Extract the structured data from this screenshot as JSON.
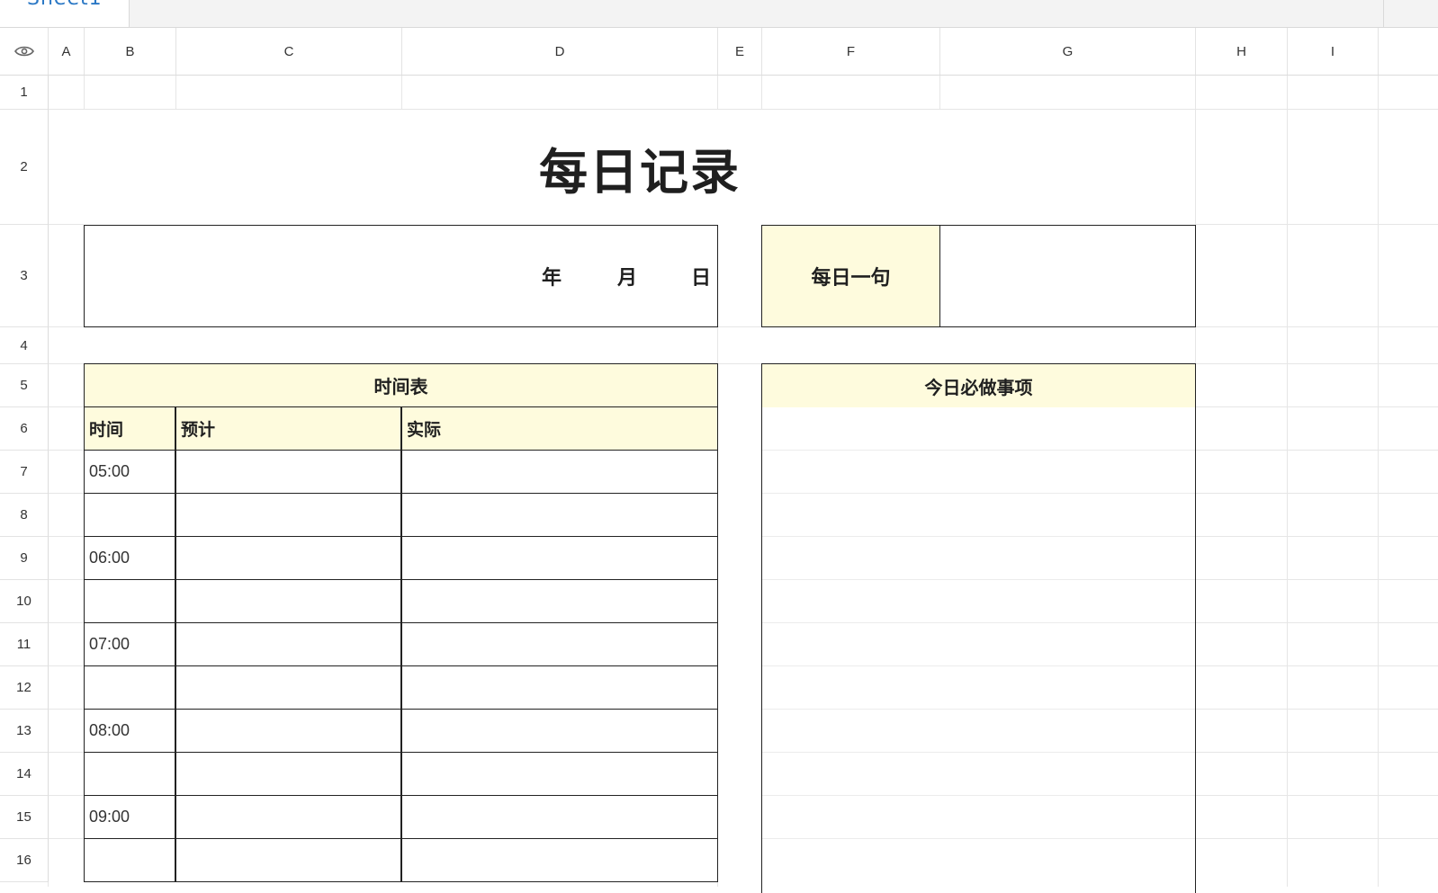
{
  "sheet_tab": {
    "label": "Sheet1"
  },
  "columns": [
    "A",
    "B",
    "C",
    "D",
    "E",
    "F",
    "G",
    "H",
    "I"
  ],
  "rows": [
    "1",
    "2",
    "3",
    "4",
    "5",
    "6",
    "7",
    "8",
    "9",
    "10",
    "11",
    "12",
    "13",
    "14",
    "15",
    "16"
  ],
  "title": "每日记录",
  "date": {
    "year": "年",
    "month": "月",
    "day": "日"
  },
  "quote": {
    "label": "每日一句",
    "value": ""
  },
  "schedule": {
    "title": "时间表",
    "headers": {
      "time": "时间",
      "planned": "预计",
      "actual": "实际"
    },
    "times": [
      "05:00",
      "",
      "06:00",
      "",
      "07:00",
      "",
      "08:00",
      "",
      "09:00",
      ""
    ]
  },
  "todo": {
    "title": "今日必做事项"
  }
}
